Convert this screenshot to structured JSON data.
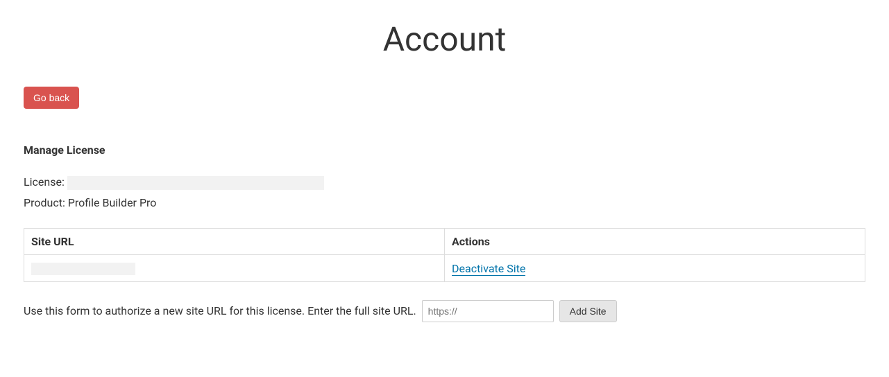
{
  "page": {
    "title": "Account"
  },
  "buttons": {
    "go_back": "Go back",
    "add_site": "Add Site"
  },
  "section": {
    "heading": "Manage License",
    "license_label": "License:",
    "license_value": "",
    "product_label": "Product:",
    "product_value": "Profile Builder Pro"
  },
  "table": {
    "columns": {
      "site_url": "Site URL",
      "actions": "Actions"
    },
    "rows": [
      {
        "site_url": "",
        "action_label": "Deactivate Site"
      }
    ]
  },
  "form": {
    "help_text": "Use this form to authorize a new site URL for this license. Enter the full site URL.",
    "placeholder": "https://"
  }
}
